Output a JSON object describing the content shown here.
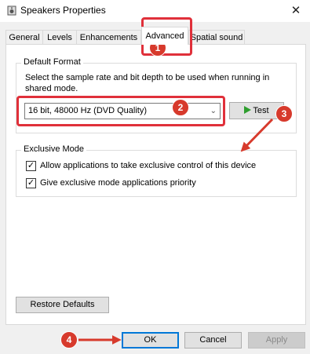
{
  "window": {
    "title": "Speakers Properties",
    "close_glyph": "✕"
  },
  "tabs": [
    {
      "label": "General"
    },
    {
      "label": "Levels"
    },
    {
      "label": "Enhancements"
    },
    {
      "label": "Advanced"
    },
    {
      "label": "Spatial sound"
    }
  ],
  "default_format": {
    "group_label": "Default Format",
    "description": "Select the sample rate and bit depth to be used when running in shared mode.",
    "selected_format": "16 bit, 48000 Hz (DVD Quality)",
    "test_label": "Test"
  },
  "exclusive_mode": {
    "group_label": "Exclusive Mode",
    "options": [
      {
        "label": "Allow applications to take exclusive control of this device",
        "checked": true
      },
      {
        "label": "Give exclusive mode applications priority",
        "checked": true
      }
    ]
  },
  "restore_defaults_label": "Restore Defaults",
  "footer": {
    "ok_label": "OK",
    "cancel_label": "Cancel",
    "apply_label": "Apply"
  },
  "annotations": {
    "step1": "1",
    "step2": "2",
    "step3": "3",
    "step4": "4"
  },
  "colors": {
    "annotation_red": "#d73a2c",
    "play_green": "#2e9e2e",
    "focus_blue": "#0078d7"
  },
  "icons": {
    "play": "play-icon",
    "window": "speaker-icon"
  }
}
